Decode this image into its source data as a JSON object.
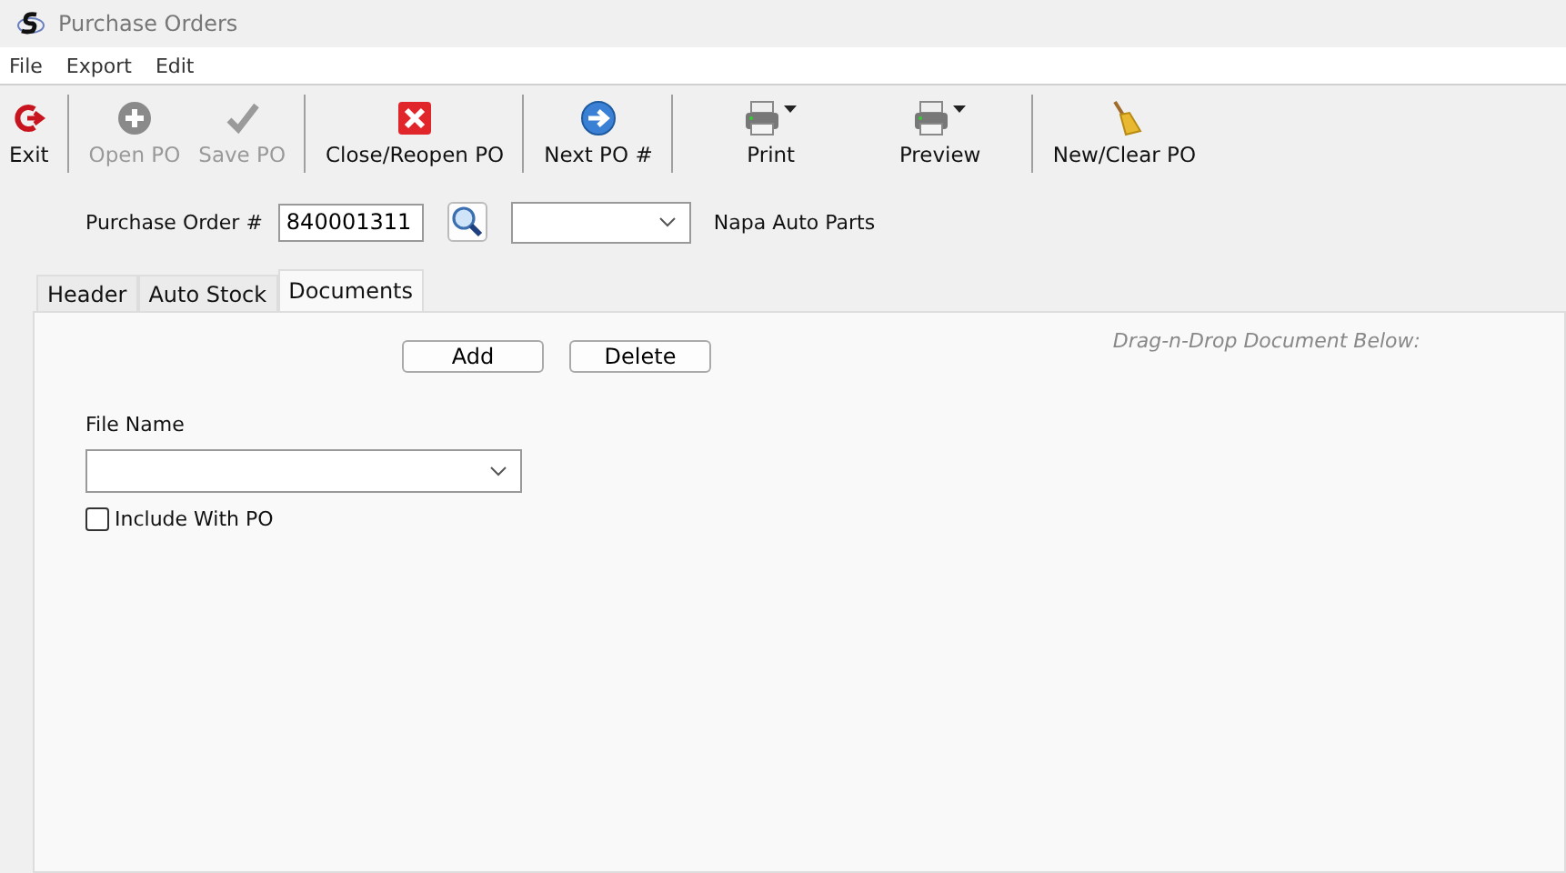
{
  "window": {
    "title": "Purchase Orders"
  },
  "menu": [
    "File",
    "Export",
    "Edit"
  ],
  "toolbar": [
    {
      "label": "Exit",
      "kind": "exit",
      "disabled": false,
      "dropdown": false,
      "separator_after": true
    },
    {
      "label": "Open PO",
      "kind": "plus",
      "disabled": true,
      "dropdown": false,
      "separator_after": false
    },
    {
      "label": "Save PO",
      "kind": "check",
      "disabled": true,
      "dropdown": false,
      "separator_after": true
    },
    {
      "label": "Close/Reopen PO",
      "kind": "close",
      "disabled": false,
      "dropdown": false,
      "separator_after": true
    },
    {
      "label": "Next PO #",
      "kind": "next",
      "disabled": false,
      "dropdown": false,
      "separator_after": true
    },
    {
      "label": "Print",
      "kind": "printer",
      "disabled": false,
      "dropdown": true,
      "separator_after": false
    },
    {
      "label": "Preview",
      "kind": "printer",
      "disabled": false,
      "dropdown": true,
      "separator_after": true
    },
    {
      "label": "New/Clear PO",
      "kind": "broom",
      "disabled": false,
      "dropdown": false,
      "separator_after": false
    }
  ],
  "po": {
    "label": "Purchase Order #",
    "value": "840001311",
    "vendor": "Napa Auto Parts"
  },
  "tabs": [
    {
      "label": "Header",
      "selected": false
    },
    {
      "label": "Auto Stock",
      "selected": false
    },
    {
      "label": "Documents",
      "selected": true
    }
  ],
  "documents": {
    "buttons": [
      "Add",
      "Delete"
    ],
    "drop_hint": "Drag-n-Drop Document Below:",
    "file_name_label": "File Name",
    "include": {
      "label": "Include With PO",
      "checked": false
    }
  }
}
